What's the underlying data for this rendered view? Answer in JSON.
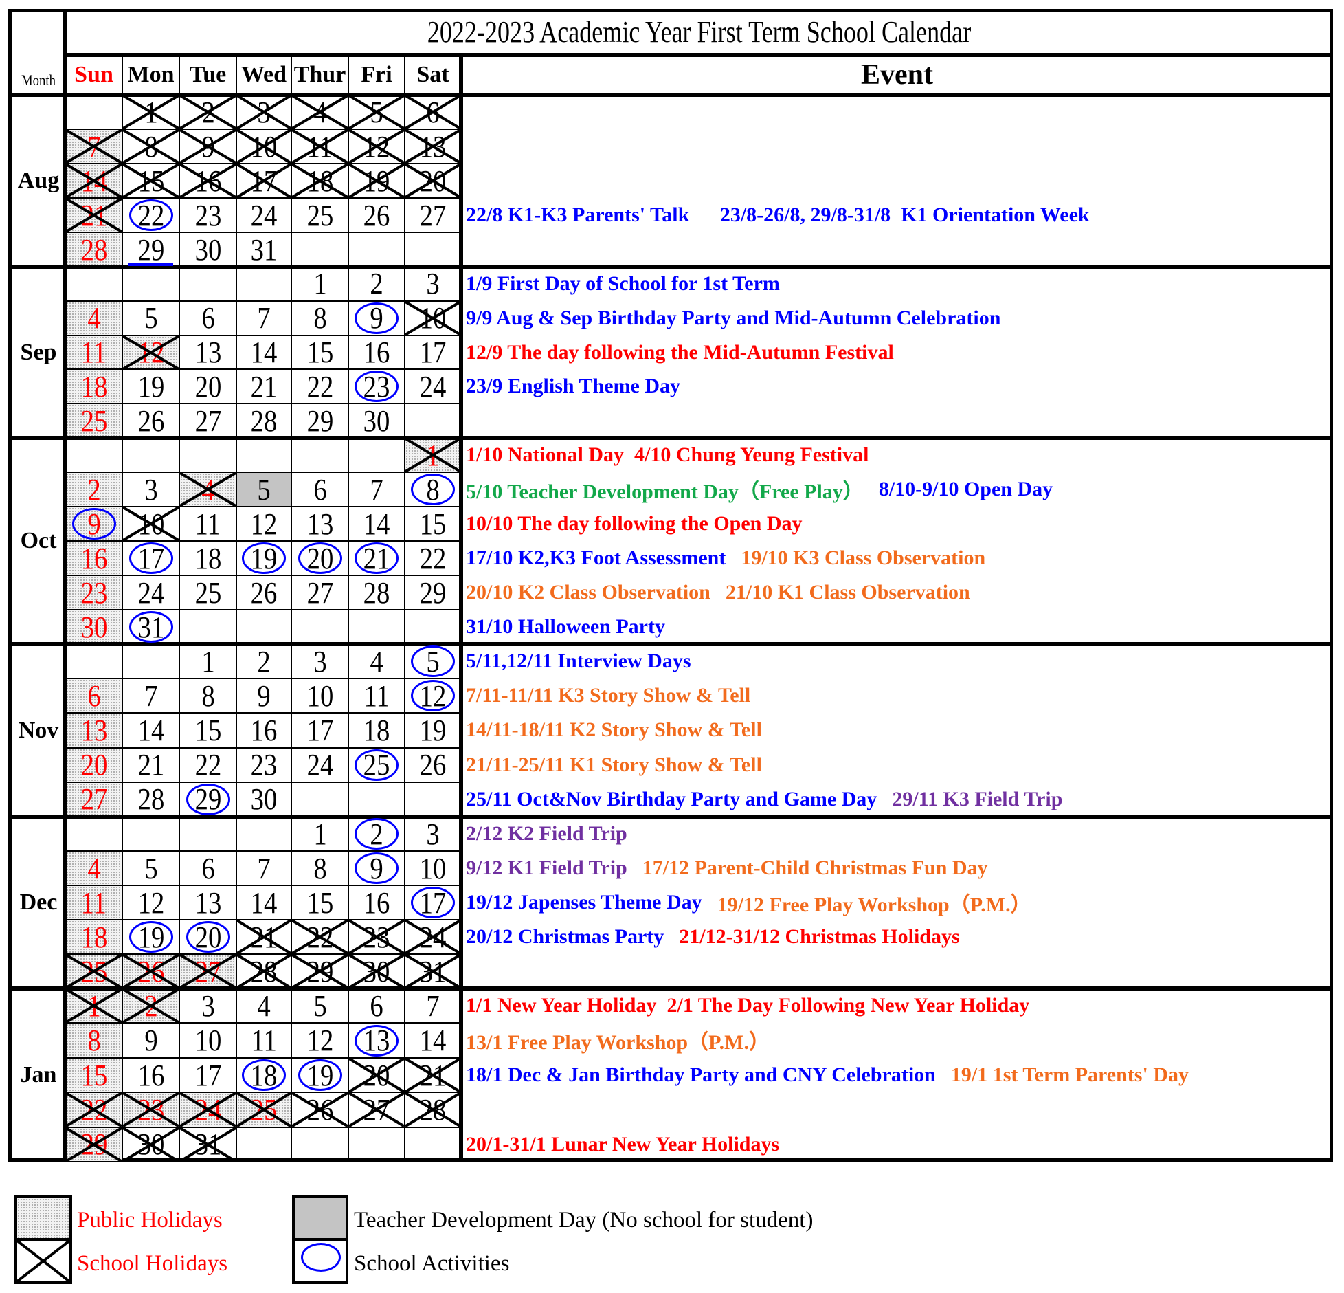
{
  "title": "2022-2023 Academic Year First Term School Calendar",
  "header": {
    "month_label": "Month",
    "weekdays": [
      "Sun",
      "Mon",
      "Tue",
      "Wed",
      "Thur",
      "Fri",
      "Sat"
    ],
    "event_label": "Event"
  },
  "colors": {
    "red": "#ff0000",
    "blue": "#0000ff",
    "orange": "#f26b1d",
    "purple": "#7030a0",
    "green": "#13a84a",
    "black": "#000000",
    "teacher_dev_gray": "#c4c4c4"
  },
  "months": [
    {
      "name": "Aug",
      "weeks": [
        [
          null,
          {
            "d": 1,
            "x": 1
          },
          {
            "d": 2,
            "x": 1
          },
          {
            "d": 3,
            "x": 1
          },
          {
            "d": 4,
            "x": 1
          },
          {
            "d": 5,
            "x": 1
          },
          {
            "d": 6,
            "x": 1
          }
        ],
        [
          {
            "d": 7,
            "r": 1,
            "s": 1,
            "x": 1
          },
          {
            "d": 8,
            "x": 1
          },
          {
            "d": 9,
            "x": 1
          },
          {
            "d": 10,
            "x": 1
          },
          {
            "d": 11,
            "x": 1
          },
          {
            "d": 12,
            "x": 1
          },
          {
            "d": 13,
            "x": 1
          }
        ],
        [
          {
            "d": 14,
            "r": 1,
            "s": 1,
            "x": 1
          },
          {
            "d": 15,
            "x": 1
          },
          {
            "d": 16,
            "x": 1
          },
          {
            "d": 17,
            "x": 1
          },
          {
            "d": 18,
            "x": 1
          },
          {
            "d": 19,
            "x": 1
          },
          {
            "d": 20,
            "x": 1
          }
        ],
        [
          {
            "d": 21,
            "r": 1,
            "s": 1,
            "x": 1
          },
          {
            "d": 22,
            "c": 1
          },
          {
            "d": 23
          },
          {
            "d": 24
          },
          {
            "d": 25
          },
          {
            "d": 26
          },
          {
            "d": 27
          }
        ],
        [
          {
            "d": 28,
            "r": 1,
            "s": 1
          },
          {
            "d": 29,
            "u": 1
          },
          {
            "d": 30
          },
          {
            "d": 31
          },
          null,
          null,
          null
        ]
      ],
      "events": [
        [],
        [],
        [],
        [
          {
            "text": "22/8 K1-K3 Parents' Talk",
            "color": "blue"
          },
          {
            "text": "   23/8-26/8, 29/8-31/8  K1 Orientation Week",
            "color": "blue"
          }
        ],
        []
      ]
    },
    {
      "name": "Sep",
      "weeks": [
        [
          null,
          null,
          null,
          null,
          {
            "d": 1
          },
          {
            "d": 2
          },
          {
            "d": 3
          }
        ],
        [
          {
            "d": 4,
            "r": 1,
            "s": 1
          },
          {
            "d": 5
          },
          {
            "d": 6
          },
          {
            "d": 7
          },
          {
            "d": 8
          },
          {
            "d": 9,
            "c": 1
          },
          {
            "d": 10,
            "x": 1
          }
        ],
        [
          {
            "d": 11,
            "r": 1,
            "s": 1
          },
          {
            "d": 12,
            "r": 1,
            "s": 1,
            "x": 1
          },
          {
            "d": 13
          },
          {
            "d": 14
          },
          {
            "d": 15
          },
          {
            "d": 16
          },
          {
            "d": 17
          }
        ],
        [
          {
            "d": 18,
            "r": 1,
            "s": 1
          },
          {
            "d": 19
          },
          {
            "d": 20
          },
          {
            "d": 21
          },
          {
            "d": 22
          },
          {
            "d": 23,
            "c": 1
          },
          {
            "d": 24
          }
        ],
        [
          {
            "d": 25,
            "r": 1,
            "s": 1
          },
          {
            "d": 26
          },
          {
            "d": 27
          },
          {
            "d": 28
          },
          {
            "d": 29
          },
          {
            "d": 30
          },
          null
        ]
      ],
      "events": [
        [
          {
            "text": "1/9 First Day of School for 1st Term",
            "color": "blue"
          }
        ],
        [
          {
            "text": "9/9 Aug & Sep Birthday Party and Mid-Autumn Celebration",
            "color": "blue"
          }
        ],
        [
          {
            "text": "12/9 The day following the Mid-Autumn Festival",
            "color": "red"
          }
        ],
        [
          {
            "text": "23/9 English Theme Day",
            "color": "blue"
          }
        ],
        []
      ]
    },
    {
      "name": "Oct",
      "weeks": [
        [
          null,
          null,
          null,
          null,
          null,
          null,
          {
            "d": 1,
            "r": 1,
            "s": 1,
            "x": 1
          }
        ],
        [
          {
            "d": 2,
            "r": 1,
            "s": 1
          },
          {
            "d": 3
          },
          {
            "d": 4,
            "r": 1,
            "s": 1,
            "x": 1
          },
          {
            "d": 5,
            "t": 1
          },
          {
            "d": 6
          },
          {
            "d": 7
          },
          {
            "d": 8,
            "c": 1
          }
        ],
        [
          {
            "d": 9,
            "r": 1,
            "s": 1,
            "c": 1
          },
          {
            "d": 10,
            "x": 1
          },
          {
            "d": 11
          },
          {
            "d": 12
          },
          {
            "d": 13
          },
          {
            "d": 14
          },
          {
            "d": 15
          }
        ],
        [
          {
            "d": 16,
            "r": 1,
            "s": 1
          },
          {
            "d": 17,
            "c": 1
          },
          {
            "d": 18
          },
          {
            "d": 19,
            "c": 1
          },
          {
            "d": 20,
            "c": 1
          },
          {
            "d": 21,
            "c": 1
          },
          {
            "d": 22
          }
        ],
        [
          {
            "d": 23,
            "r": 1,
            "s": 1
          },
          {
            "d": 24
          },
          {
            "d": 25
          },
          {
            "d": 26
          },
          {
            "d": 27
          },
          {
            "d": 28
          },
          {
            "d": 29
          }
        ],
        [
          {
            "d": 30,
            "r": 1,
            "s": 1
          },
          {
            "d": 31,
            "c": 1
          },
          null,
          null,
          null,
          null,
          null
        ]
      ],
      "events": [
        [
          {
            "text": "1/10 National Day  4/10 Chung Yeung Festival",
            "color": "red"
          }
        ],
        [
          {
            "text": "5/10 Teacher Development Day（Free Play）",
            "color": "green"
          },
          {
            "text": "8/10-9/10 Open Day",
            "color": "blue"
          }
        ],
        [
          {
            "text": "10/10 The day following the Open Day",
            "color": "red"
          }
        ],
        [
          {
            "text": "17/10 K2,K3 Foot Assessment",
            "color": "blue"
          },
          {
            "text": "19/10 K3 Class Observation",
            "color": "orange"
          }
        ],
        [
          {
            "text": "20/10 K2 Class Observation",
            "color": "orange"
          },
          {
            "text": "21/10 K1 Class Observation",
            "color": "orange"
          }
        ],
        [
          {
            "text": "31/10 Halloween Party",
            "color": "blue"
          }
        ]
      ]
    },
    {
      "name": "Nov",
      "weeks": [
        [
          null,
          null,
          {
            "d": 1
          },
          {
            "d": 2
          },
          {
            "d": 3
          },
          {
            "d": 4
          },
          {
            "d": 5,
            "c": 1
          }
        ],
        [
          {
            "d": 6,
            "r": 1,
            "s": 1
          },
          {
            "d": 7
          },
          {
            "d": 8
          },
          {
            "d": 9
          },
          {
            "d": 10
          },
          {
            "d": 11
          },
          {
            "d": 12,
            "c": 1
          }
        ],
        [
          {
            "d": 13,
            "r": 1,
            "s": 1
          },
          {
            "d": 14
          },
          {
            "d": 15
          },
          {
            "d": 16
          },
          {
            "d": 17
          },
          {
            "d": 18
          },
          {
            "d": 19
          }
        ],
        [
          {
            "d": 20,
            "r": 1,
            "s": 1
          },
          {
            "d": 21
          },
          {
            "d": 22
          },
          {
            "d": 23
          },
          {
            "d": 24
          },
          {
            "d": 25,
            "c": 1
          },
          {
            "d": 26
          }
        ],
        [
          {
            "d": 27,
            "r": 1,
            "s": 1
          },
          {
            "d": 28
          },
          {
            "d": 29,
            "c": 1
          },
          {
            "d": 30
          },
          null,
          null,
          null
        ]
      ],
      "events": [
        [
          {
            "text": "5/11,12/11 Interview Days",
            "color": "blue"
          }
        ],
        [
          {
            "text": "7/11-11/11 K3 Story Show & Tell",
            "color": "orange"
          }
        ],
        [
          {
            "text": "14/11-18/11 K2 Story Show & Tell",
            "color": "orange"
          }
        ],
        [
          {
            "text": "21/11-25/11 K1 Story Show & Tell",
            "color": "orange"
          }
        ],
        [
          {
            "text": "25/11 Oct&Nov Birthday Party and Game Day",
            "color": "blue"
          },
          {
            "text": "29/11 K3 Field Trip",
            "color": "purple"
          }
        ]
      ]
    },
    {
      "name": "Dec",
      "weeks": [
        [
          null,
          null,
          null,
          null,
          {
            "d": 1
          },
          {
            "d": 2,
            "c": 1
          },
          {
            "d": 3
          }
        ],
        [
          {
            "d": 4,
            "r": 1,
            "s": 1
          },
          {
            "d": 5
          },
          {
            "d": 6
          },
          {
            "d": 7
          },
          {
            "d": 8
          },
          {
            "d": 9,
            "c": 1
          },
          {
            "d": 10
          }
        ],
        [
          {
            "d": 11,
            "r": 1,
            "s": 1
          },
          {
            "d": 12
          },
          {
            "d": 13
          },
          {
            "d": 14
          },
          {
            "d": 15
          },
          {
            "d": 16
          },
          {
            "d": 17,
            "c": 1
          }
        ],
        [
          {
            "d": 18,
            "r": 1,
            "s": 1
          },
          {
            "d": 19,
            "c": 1
          },
          {
            "d": 20,
            "c": 1
          },
          {
            "d": 21,
            "x": 1
          },
          {
            "d": 22,
            "x": 1
          },
          {
            "d": 23,
            "x": 1
          },
          {
            "d": 24,
            "x": 1
          }
        ],
        [
          {
            "d": 25,
            "r": 1,
            "s": 1,
            "x": 1
          },
          {
            "d": 26,
            "r": 1,
            "s": 1,
            "x": 1
          },
          {
            "d": 27,
            "r": 1,
            "s": 1,
            "x": 1
          },
          {
            "d": 28,
            "x": 1
          },
          {
            "d": 29,
            "x": 1
          },
          {
            "d": 30,
            "x": 1
          },
          {
            "d": 31,
            "x": 1
          }
        ]
      ],
      "events": [
        [
          {
            "text": "2/12 K2 Field Trip",
            "color": "purple"
          }
        ],
        [
          {
            "text": "9/12 K1 Field Trip",
            "color": "purple"
          },
          {
            "text": "17/12 Parent-Child Christmas Fun Day",
            "color": "orange"
          }
        ],
        [
          {
            "text": "19/12 Japenses Theme Day",
            "color": "blue"
          },
          {
            "text": "19/12 Free Play Workshop（P.M.）",
            "color": "orange"
          }
        ],
        [
          {
            "text": "20/12 Christmas Party",
            "color": "blue"
          },
          {
            "text": "21/12-31/12 Christmas Holidays",
            "color": "red"
          }
        ],
        []
      ]
    },
    {
      "name": "Jan",
      "weeks": [
        [
          {
            "d": 1,
            "r": 1,
            "s": 1,
            "x": 1
          },
          {
            "d": 2,
            "r": 1,
            "s": 1,
            "x": 1
          },
          {
            "d": 3
          },
          {
            "d": 4
          },
          {
            "d": 5
          },
          {
            "d": 6
          },
          {
            "d": 7
          }
        ],
        [
          {
            "d": 8,
            "r": 1,
            "s": 1
          },
          {
            "d": 9
          },
          {
            "d": 10
          },
          {
            "d": 11
          },
          {
            "d": 12
          },
          {
            "d": 13,
            "c": 1
          },
          {
            "d": 14
          }
        ],
        [
          {
            "d": 15,
            "r": 1,
            "s": 1
          },
          {
            "d": 16
          },
          {
            "d": 17
          },
          {
            "d": 18,
            "c": 1
          },
          {
            "d": 19,
            "c": 1
          },
          {
            "d": 20,
            "x": 1
          },
          {
            "d": 21,
            "x": 1
          }
        ],
        [
          {
            "d": 22,
            "r": 1,
            "s": 1,
            "x": 1
          },
          {
            "d": 23,
            "r": 1,
            "s": 1,
            "x": 1
          },
          {
            "d": 24,
            "r": 1,
            "s": 1,
            "x": 1
          },
          {
            "d": 25,
            "r": 1,
            "s": 1,
            "x": 1
          },
          {
            "d": 26,
            "x": 1
          },
          {
            "d": 27,
            "x": 1
          },
          {
            "d": 28,
            "x": 1
          }
        ],
        [
          {
            "d": 29,
            "r": 1,
            "s": 1,
            "x": 1
          },
          {
            "d": 30,
            "x": 1
          },
          {
            "d": 31,
            "x": 1
          },
          null,
          null,
          null,
          null
        ]
      ],
      "events": [
        [
          {
            "text": "1/1 New Year Holiday  2/1 The Day Following New Year Holiday",
            "color": "red"
          }
        ],
        [
          {
            "text": "13/1 Free Play Workshop（P.M.）",
            "color": "orange"
          }
        ],
        [
          {
            "text": "18/1 Dec & Jan Birthday Party and CNY Celebration",
            "color": "blue"
          },
          {
            "text": "19/1 1st Term Parents' Day",
            "color": "orange"
          }
        ],
        [],
        [
          {
            "text": "20/1-31/1 Lunar New Year Holidays",
            "color": "red"
          }
        ]
      ]
    }
  ],
  "legend": {
    "public_holidays": "Public Holidays",
    "school_holidays": "School Holidays",
    "teacher_dev_day": "Teacher Development Day (No school for student)",
    "school_activities": "School Activities"
  }
}
